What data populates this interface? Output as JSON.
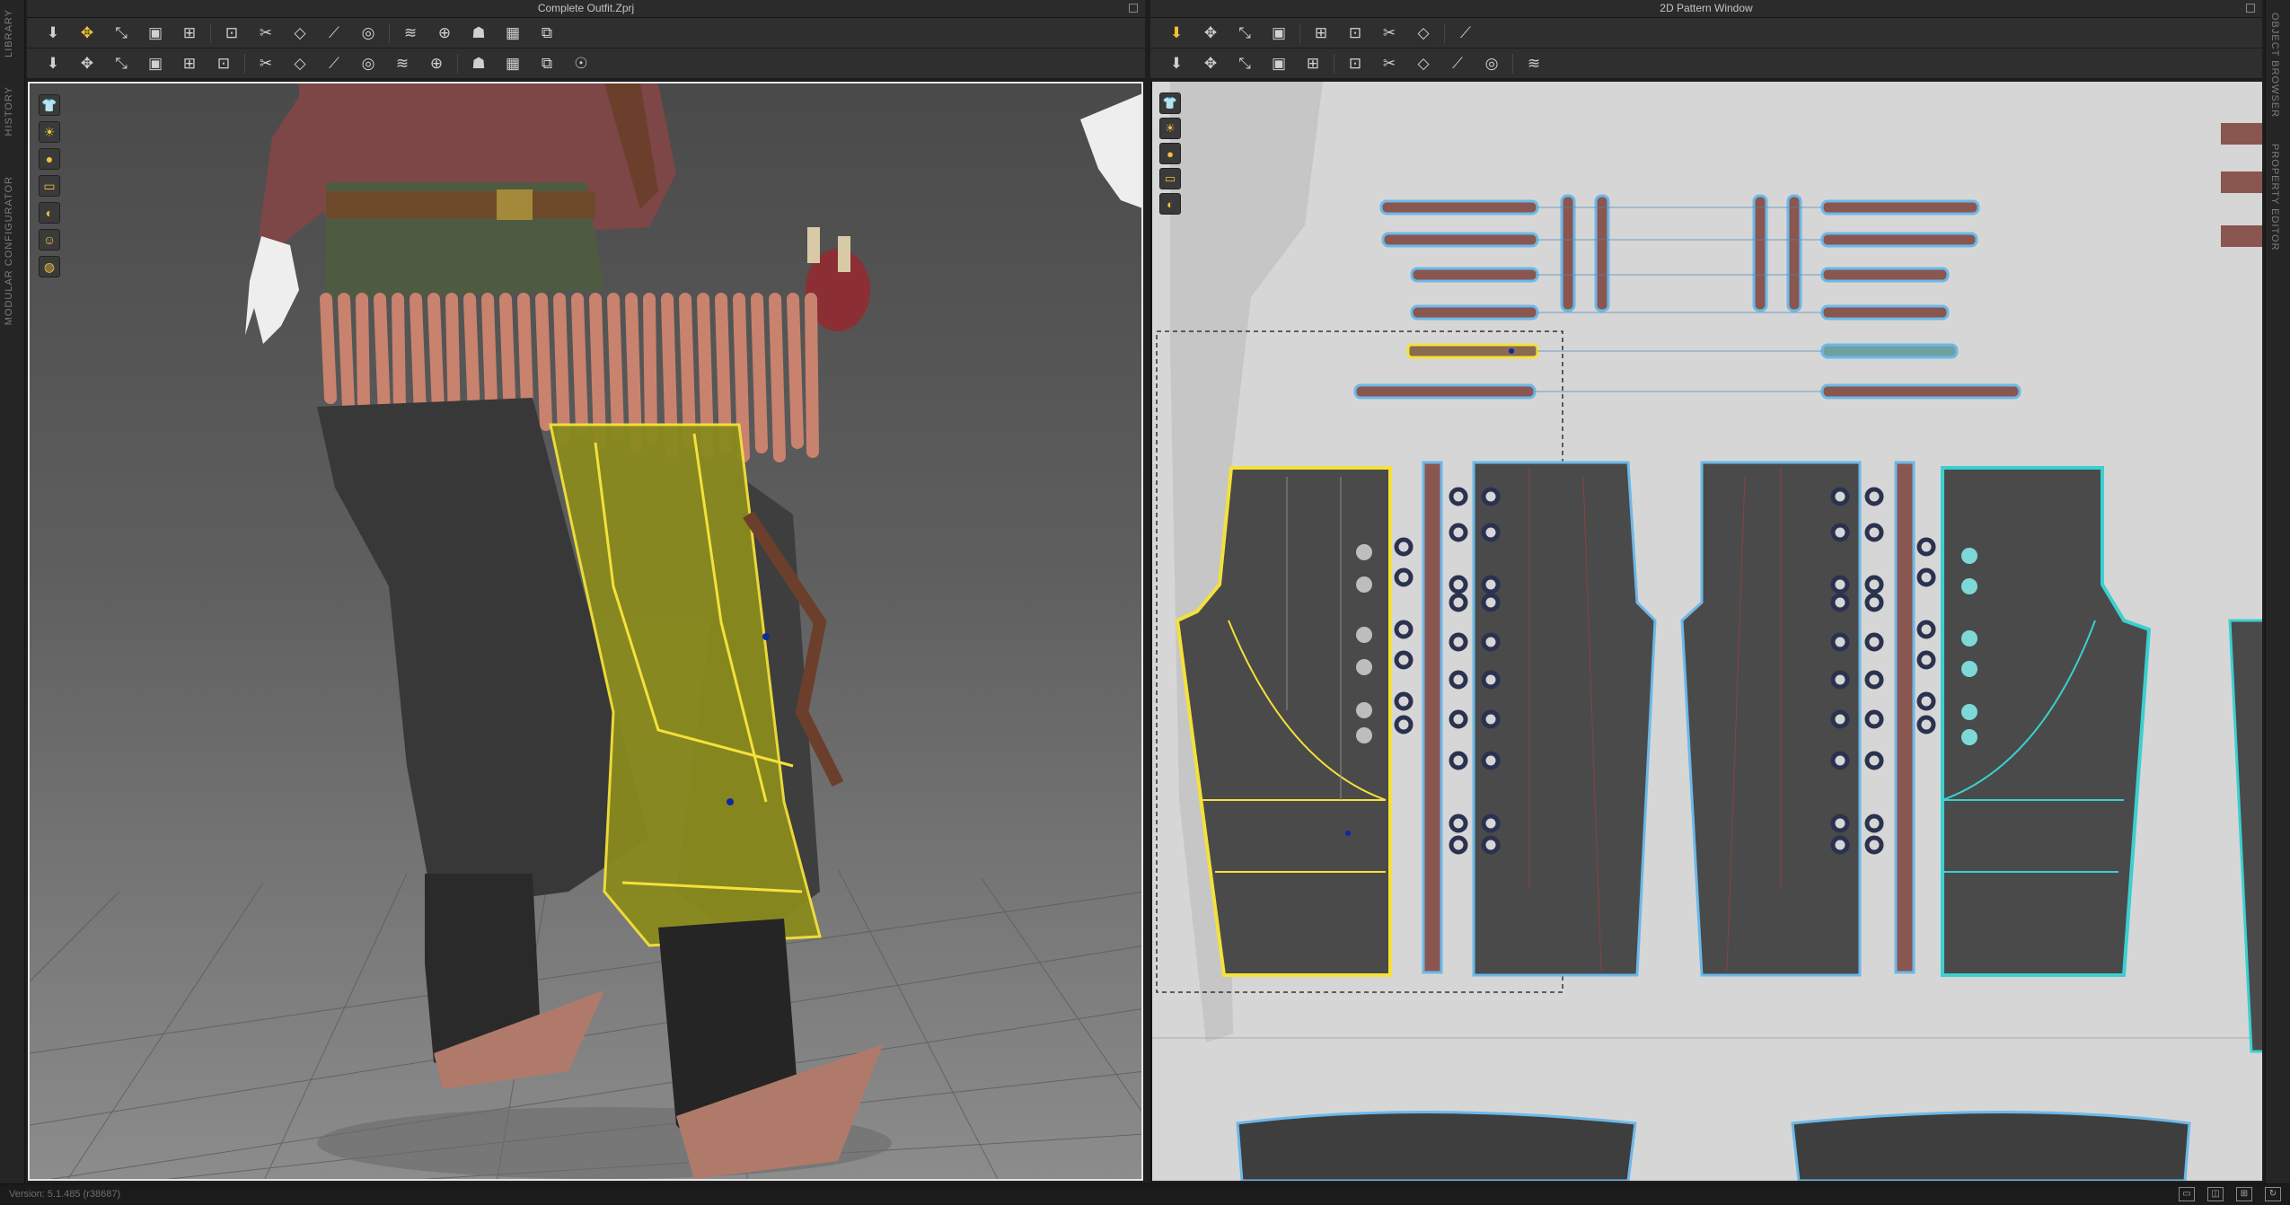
{
  "left_rail": {
    "tabs": [
      "LIBRARY",
      "HISTORY",
      "MODULAR CONFIGURATOR"
    ]
  },
  "right_rail": {
    "tabs": [
      "OBJECT BROWSER",
      "PROPERTY EDITOR"
    ]
  },
  "pane_3d": {
    "title": "Complete Outfit.Zprj",
    "toolbar_row1": [
      "simulate-icon",
      "move-icon",
      "transform-icon",
      "select-mesh-icon",
      "edit-pin-icon",
      "tack-icon",
      "seam-icon",
      "fold-icon",
      "line-icon",
      "button-icon",
      "pleat-icon",
      "fit-icon",
      "avatar-icon",
      "grid-icon",
      "shell-icon"
    ],
    "toolbar_row2": [
      "walk-icon",
      "pin-icon",
      "strap-icon",
      "measure-icon",
      "cut-icon",
      "trim-icon",
      "texture-icon",
      "topstitch-icon",
      "puckering-icon",
      "pattern-icon",
      "sphere-icon",
      "layer-icon",
      "zipper-icon",
      "size-icon",
      "hanger-icon",
      "move-axis-icon"
    ],
    "view_tools": [
      "shirt-icon",
      "sun-icon",
      "avatar-view-icon",
      "pattern-view-icon",
      "texture-view-icon",
      "avatar-skin-icon",
      "globe-icon"
    ]
  },
  "pane_2d": {
    "title": "2D Pattern Window",
    "toolbar_row1": [
      "transform-pattern-icon",
      "edit-point-icon",
      "polygon-icon",
      "rectangle-icon",
      "image-icon",
      "ring-icon",
      "arrange-icon",
      "grid-icon",
      "grid-alt-icon"
    ],
    "toolbar_row2": [
      "dart-icon",
      "internal-polygon-icon",
      "internal-rect-icon",
      "trace-icon",
      "fold-pleat-icon",
      "button2d-icon",
      "segment-sew-icon",
      "free-sew-icon",
      "tuck-icon",
      "ruler-icon",
      "baseline-icon"
    ],
    "view_tools": [
      "pen-icon",
      "pin2d-icon",
      "info-icon",
      "pattern-color-icon",
      "texture2d-icon"
    ]
  },
  "status": {
    "version": "Version: 5.1.485 (r38687)",
    "icons": [
      "single-view-icon",
      "split-view-icon",
      "dual-view-icon",
      "refresh-icon"
    ]
  },
  "colors": {
    "selection": "#f4e13a",
    "pattern_fill": "#4a4a4a",
    "strap_fill": "#8a5650",
    "outline_blue": "#6cb8e8",
    "cyan_pattern": "#3ad0d0",
    "canvas_2d": "#d6d6d6"
  }
}
